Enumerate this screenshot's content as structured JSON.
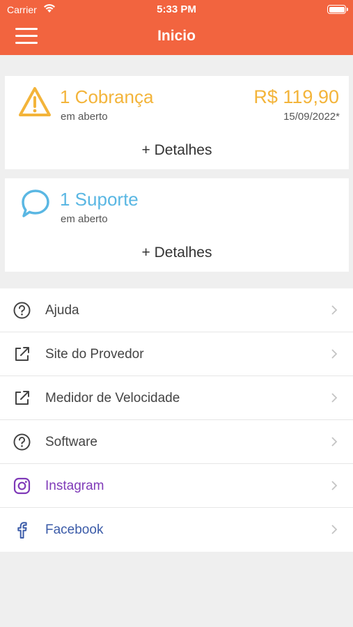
{
  "status_bar": {
    "carrier": "Carrier",
    "time": "5:33 PM"
  },
  "header": {
    "title": "Inicio"
  },
  "billing_card": {
    "title": "1 Cobrança",
    "subtitle": "em aberto",
    "amount": "R$ 119,90",
    "due_date": "15/09/2022*",
    "details_label": "+ Detalhes",
    "icon": "warning-icon",
    "color": "#f3b43a"
  },
  "support_card": {
    "title": "1 Suporte",
    "subtitle": "em aberto",
    "details_label": "+ Detalhes",
    "icon": "chat-bubble-icon",
    "color": "#5ab7e3"
  },
  "menu": [
    {
      "label": "Ajuda",
      "icon": "help-circle-icon"
    },
    {
      "label": "Site do Provedor",
      "icon": "external-link-icon"
    },
    {
      "label": "Medidor de Velocidade",
      "icon": "external-link-icon"
    },
    {
      "label": "Software",
      "icon": "help-circle-icon"
    },
    {
      "label": "Instagram",
      "icon": "instagram-icon",
      "color": "#7f3ab8"
    },
    {
      "label": "Facebook",
      "icon": "facebook-icon",
      "color": "#3b5ba8"
    }
  ],
  "colors": {
    "header": "#f2643f",
    "background": "#efefef"
  }
}
